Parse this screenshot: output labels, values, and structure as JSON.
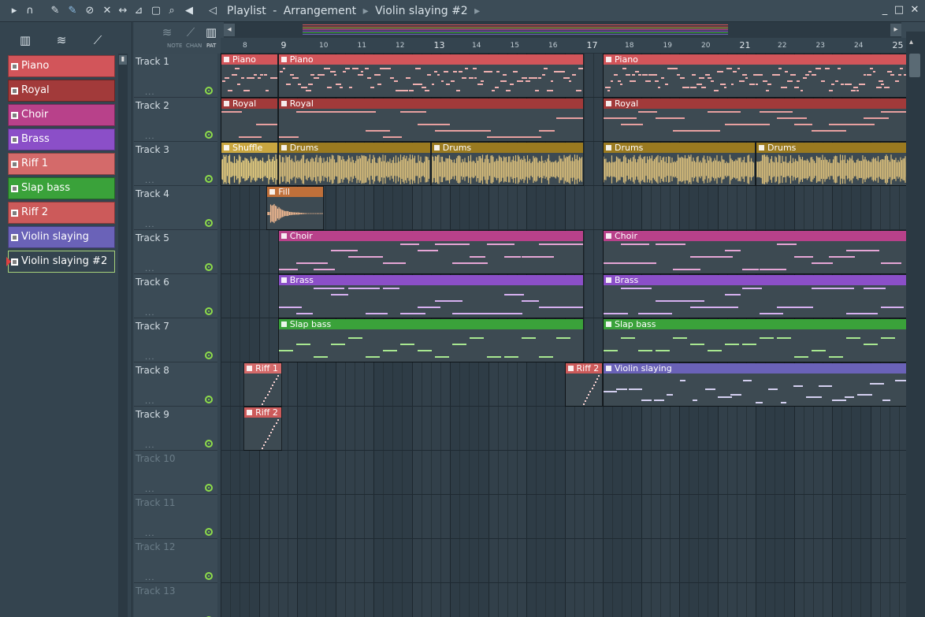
{
  "title": {
    "parts": [
      "Playlist",
      "Arrangement",
      "Violin slaying #2"
    ],
    "sep_dash": "-"
  },
  "toolbar_icons": [
    "play-arrow-icon",
    "magnet-icon",
    "pencil-icon",
    "brush-icon",
    "delete-icon",
    "mute-icon",
    "slip-icon",
    "slice-icon",
    "select-icon",
    "zoom-icon",
    "speaker-icon"
  ],
  "left_tools": [
    "piano-roll-icon",
    "audio-wave-icon",
    "automation-icon"
  ],
  "patterns": [
    {
      "label": "Piano",
      "color": "#d2555a"
    },
    {
      "label": "Royal",
      "color": "#a23a3a"
    },
    {
      "label": "Choir",
      "color": "#b8418a"
    },
    {
      "label": "Brass",
      "color": "#8b4fc8"
    },
    {
      "label": "Riff 1",
      "color": "#d46a6a"
    },
    {
      "label": "Slap bass",
      "color": "#3aa23a"
    },
    {
      "label": "Riff 2",
      "color": "#cc5a5a"
    },
    {
      "label": "Violin slaying",
      "color": "#6a62b8"
    },
    {
      "label": "Violin slaying #2",
      "color": "#34444f"
    }
  ],
  "modes": {
    "note": "NOTE",
    "chan": "CHAN",
    "pat": "PAT"
  },
  "bars": [
    "8",
    "9",
    "10",
    "11",
    "12",
    "13",
    "14",
    "15",
    "16",
    "17",
    "18",
    "19",
    "20",
    "21",
    "22",
    "23",
    "24",
    "25"
  ],
  "tracks": [
    "Track 1",
    "Track 2",
    "Track 3",
    "Track 4",
    "Track 5",
    "Track 6",
    "Track 7",
    "Track 8",
    "Track 9",
    "Track 10",
    "Track 11",
    "Track 12",
    "Track 13"
  ],
  "track_dots": "...",
  "clips": [
    {
      "track": 0,
      "label": "Piano",
      "start": 0,
      "len": 1.5,
      "color": "#d2555a",
      "note": "#f0b0b0",
      "kind": "piano"
    },
    {
      "track": 0,
      "label": "Piano",
      "start": 1.5,
      "len": 8,
      "color": "#d2555a",
      "note": "#f0b0b0",
      "kind": "piano"
    },
    {
      "track": 0,
      "label": "Piano",
      "start": 10,
      "len": 8,
      "color": "#d2555a",
      "note": "#f0b0b0",
      "kind": "piano"
    },
    {
      "track": 1,
      "label": "Royal",
      "start": 0,
      "len": 1.5,
      "color": "#a23a3a",
      "note": "#e8a0a0",
      "kind": "chords"
    },
    {
      "track": 1,
      "label": "Royal",
      "start": 1.5,
      "len": 8,
      "color": "#a23a3a",
      "note": "#e8a0a0",
      "kind": "chords"
    },
    {
      "track": 1,
      "label": "Royal",
      "start": 10,
      "len": 8,
      "color": "#a23a3a",
      "note": "#e8a0a0",
      "kind": "chords"
    },
    {
      "track": 2,
      "label": "Shuffle",
      "start": 0,
      "len": 1.5,
      "color": "#c9a640",
      "note": "#e6cc7e",
      "kind": "wave"
    },
    {
      "track": 2,
      "label": "Drums",
      "start": 1.5,
      "len": 4,
      "color": "#9a7a20",
      "note": "#d8bd7a",
      "kind": "wave"
    },
    {
      "track": 2,
      "label": "Drums",
      "start": 5.5,
      "len": 4,
      "color": "#9a7a20",
      "note": "#d8bd7a",
      "kind": "wave"
    },
    {
      "track": 2,
      "label": "Drums",
      "start": 10,
      "len": 4,
      "color": "#9a7a20",
      "note": "#d8bd7a",
      "kind": "wave"
    },
    {
      "track": 2,
      "label": "Drums",
      "start": 14,
      "len": 4,
      "color": "#9a7a20",
      "note": "#d8bd7a",
      "kind": "wave"
    },
    {
      "track": 3,
      "label": "Fill",
      "start": 1.2,
      "len": 1.5,
      "color": "#c0703a",
      "note": "#f0b890",
      "kind": "fill"
    },
    {
      "track": 4,
      "label": "Choir",
      "start": 1.5,
      "len": 8,
      "color": "#b8418a",
      "note": "#e6a6d6",
      "kind": "chords"
    },
    {
      "track": 4,
      "label": "Choir",
      "start": 10,
      "len": 8,
      "color": "#b8418a",
      "note": "#e6a6d6",
      "kind": "chords"
    },
    {
      "track": 5,
      "label": "Brass",
      "start": 1.5,
      "len": 8,
      "color": "#8b4fc8",
      "note": "#d6b0f0",
      "kind": "chords"
    },
    {
      "track": 5,
      "label": "Brass",
      "start": 10,
      "len": 8,
      "color": "#8b4fc8",
      "note": "#d6b0f0",
      "kind": "chords"
    },
    {
      "track": 6,
      "label": "Slap bass",
      "start": 1.5,
      "len": 8,
      "color": "#3aa23a",
      "note": "#a8e890",
      "kind": "bass"
    },
    {
      "track": 6,
      "label": "Slap bass",
      "start": 10,
      "len": 8,
      "color": "#3aa23a",
      "note": "#a8e890",
      "kind": "bass"
    },
    {
      "track": 7,
      "label": "Riff 1",
      "start": 0.6,
      "len": 1,
      "color": "#d46a6a",
      "note": "#f6d0d0",
      "kind": "riff"
    },
    {
      "track": 7,
      "label": "Riff 2",
      "start": 9,
      "len": 1,
      "color": "#cc5a5a",
      "note": "#f6d0d0",
      "kind": "riff"
    },
    {
      "track": 7,
      "label": "Violin slaying",
      "start": 10,
      "len": 8,
      "color": "#6a62b8",
      "note": "#d4d0f0",
      "kind": "violin"
    },
    {
      "track": 8,
      "label": "Riff 2",
      "start": 0.6,
      "len": 1,
      "color": "#cc5a5a",
      "note": "#f6d0d0",
      "kind": "riff"
    }
  ],
  "colors": {
    "bg": "#34444f",
    "grid": "#2e3c46",
    "accent_led": "#8ddc4a"
  }
}
